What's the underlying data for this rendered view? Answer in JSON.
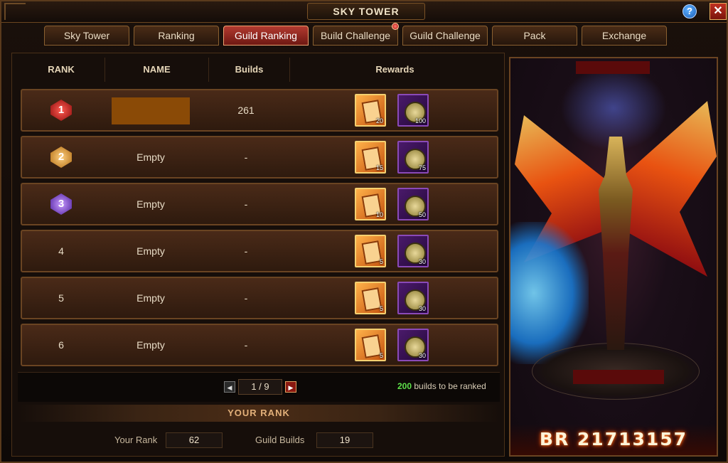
{
  "window": {
    "title": "SKY TOWER",
    "help_label": "?",
    "close_label": "✕"
  },
  "tabs": [
    {
      "label": "Sky Tower"
    },
    {
      "label": "Ranking"
    },
    {
      "label": "Guild Ranking",
      "active": true
    },
    {
      "label": "Build Challenge"
    },
    {
      "label": "Guild Challenge"
    },
    {
      "label": "Pack"
    },
    {
      "label": "Exchange"
    }
  ],
  "table": {
    "headers": {
      "rank": "RANK",
      "name": "NAME",
      "builds": "Builds",
      "rewards": "Rewards"
    },
    "rows": [
      {
        "rank": "1",
        "name": "",
        "builds": "261",
        "reward_scroll_qty": "20",
        "reward_coin_qty": "100"
      },
      {
        "rank": "2",
        "name": "Empty",
        "builds": "-",
        "reward_scroll_qty": "15",
        "reward_coin_qty": "75"
      },
      {
        "rank": "3",
        "name": "Empty",
        "builds": "-",
        "reward_scroll_qty": "10",
        "reward_coin_qty": "50"
      },
      {
        "rank": "4",
        "name": "Empty",
        "builds": "-",
        "reward_scroll_qty": "5",
        "reward_coin_qty": "30"
      },
      {
        "rank": "5",
        "name": "Empty",
        "builds": "-",
        "reward_scroll_qty": "5",
        "reward_coin_qty": "30"
      },
      {
        "rank": "6",
        "name": "Empty",
        "builds": "-",
        "reward_scroll_qty": "5",
        "reward_coin_qty": "30"
      }
    ]
  },
  "pager": {
    "page": "1 / 9",
    "prev": "◀",
    "next": "▶"
  },
  "ranked_note": {
    "count": "200",
    "text": "builds to be ranked"
  },
  "your_rank": {
    "heading": "YOUR RANK",
    "rank_label": "Your Rank",
    "rank_value": "62",
    "builds_label": "Guild Builds",
    "builds_value": "19"
  },
  "character": {
    "br_label": "BR 21713157"
  },
  "colors": {
    "accent_green": "#5ee04a",
    "active_tab": "#b23a30"
  }
}
